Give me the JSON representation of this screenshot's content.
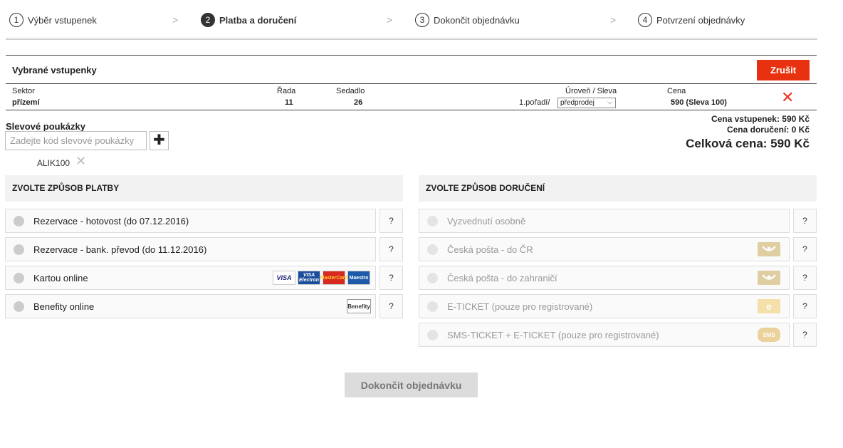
{
  "steps": [
    {
      "num": "1",
      "label": "Výběr vstupenek"
    },
    {
      "num": "2",
      "label": "Platba a doručení"
    },
    {
      "num": "3",
      "label": "Dokončit objednávku"
    },
    {
      "num": "4",
      "label": "Potvrzení objednávky"
    }
  ],
  "step_arrow": ">",
  "active_step": 2,
  "tickets": {
    "title": "Vybrané vstupenky",
    "cancel_label": "Zrušit",
    "headers": {
      "sector": "Sektor",
      "row": "Řada",
      "seat": "Sedadlo",
      "level": "Úroveň / Sleva",
      "price": "Cena"
    },
    "row": {
      "sector": "přízemí",
      "row": "11",
      "seat": "26",
      "level": "1.pořadí/",
      "discount_select": "předprodej",
      "price": "590  (Sleva 100)"
    },
    "delete_glyph": "✕"
  },
  "vouchers": {
    "title": "Slevové poukázky",
    "placeholder": "Zadejte kód slevové poukázky",
    "add_glyph": "✚",
    "applied_code": "ALIK100",
    "remove_glyph": "✕"
  },
  "totals": {
    "tickets": "Cena vstupenek: 590 Kč",
    "delivery": "Cena doručení: 0 Kč",
    "total": "Celková cena: 590 Kč"
  },
  "payment": {
    "title": "ZVOLTE ZPŮSOB PLATBY",
    "options": [
      {
        "label": "Rezervace - hotovost (do 07.12.2016)"
      },
      {
        "label": "Rezervace - bank. převod (do 11.12.2016)"
      },
      {
        "label": "Kartou online",
        "icons": [
          "VISA",
          "VISA Electron",
          "MasterCard",
          "Maestro"
        ]
      },
      {
        "label": "Benefity online",
        "icon": "Benefity"
      }
    ]
  },
  "delivery": {
    "title": "ZVOLTE ZPŮSOB DORUČENÍ",
    "options": [
      {
        "label": "Vyzvednutí osobně"
      },
      {
        "label": "Česká pošta - do ČR",
        "icon": "posthorn-icon"
      },
      {
        "label": "Česká pošta - do zahraničí",
        "icon": "posthorn-icon"
      },
      {
        "label": "E-TICKET (pouze pro registrované)",
        "icon": "e-ticket-icon"
      },
      {
        "label": "SMS-TICKET + E-TICKET (pouze pro registrované)",
        "icon": "sms-icon"
      }
    ]
  },
  "help_label": "?",
  "finish_label": "Dokončit objednávku",
  "colors": {
    "accent": "#e8320f",
    "panel": "#f2f2f2",
    "disabled_button": "#dcdcdc"
  }
}
